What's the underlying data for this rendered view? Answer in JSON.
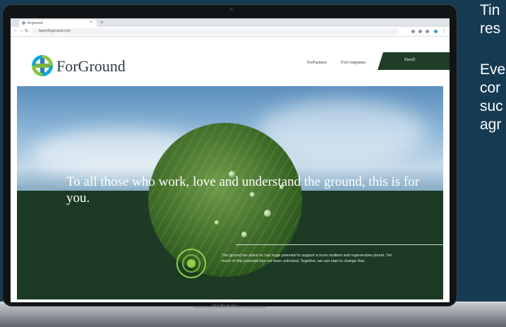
{
  "side_text": {
    "line1": "Tin",
    "line2": "res",
    "line3": "Eve",
    "line4": "cor",
    "line5": "suc",
    "line6": "agr"
  },
  "laptop": {
    "model_label": "MacBook Pro"
  },
  "browser": {
    "tab_title": "forground",
    "url": "bayerforground.com",
    "new_tab": "+",
    "tab_close": "×"
  },
  "site": {
    "logo_text": "ForGround",
    "nav": [
      {
        "label": "ForFarmers"
      },
      {
        "label": "ForCompanies"
      }
    ],
    "nav_cta": "Enroll",
    "hero": {
      "headline": "To all those who work, love and understand the ground, this is for you.",
      "body": "The ground we stand on has huge potential to support a more resilient and regenerative planet. Yet much of this potential has not been unlocked. Together, we can start to change that."
    }
  },
  "colors": {
    "background": "#163a52",
    "panel_green": "#1c3a24",
    "accent_green": "#8ed14b"
  }
}
